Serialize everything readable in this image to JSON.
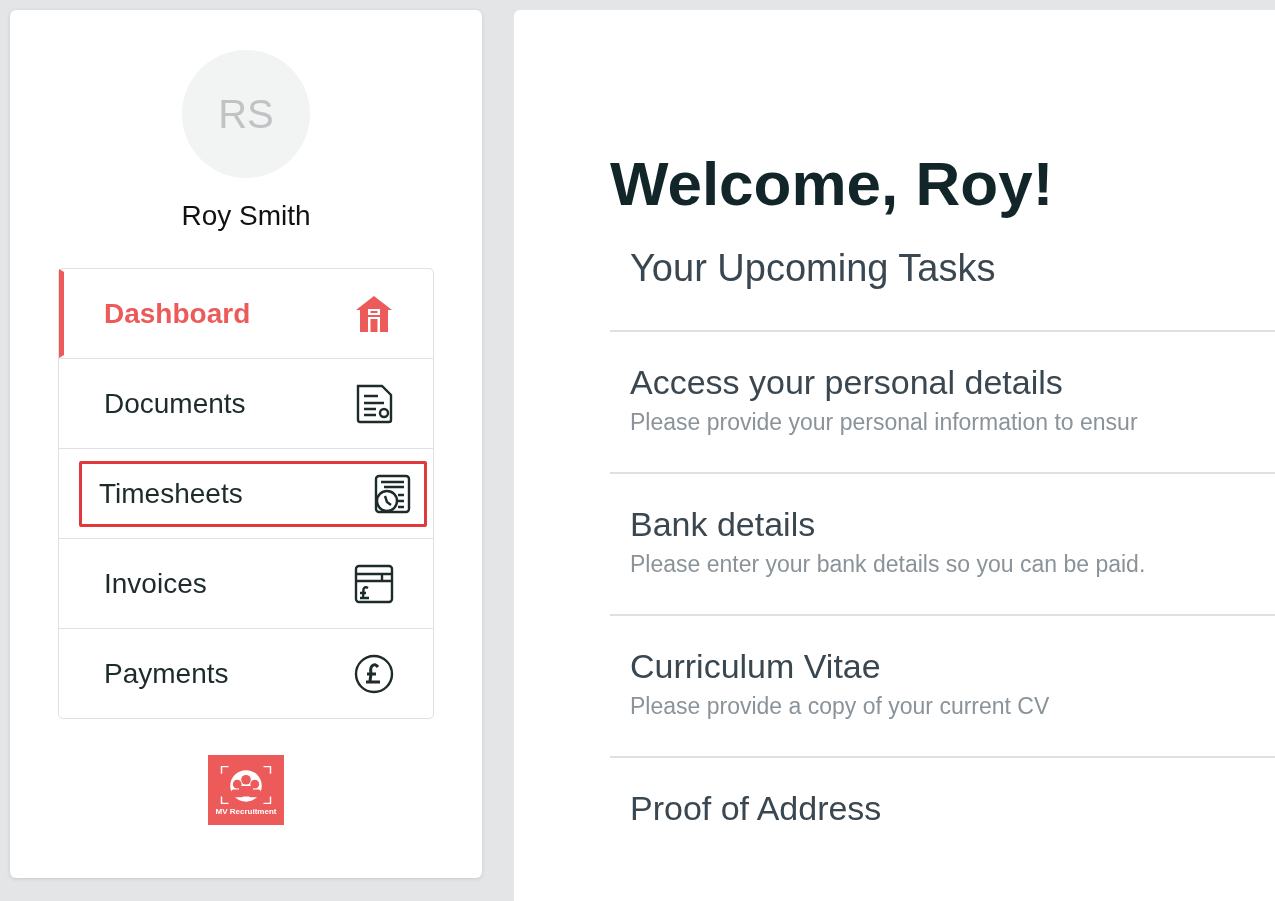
{
  "profile": {
    "initials": "RS",
    "name": "Roy Smith"
  },
  "nav": [
    {
      "label": "Dashboard",
      "selected": true,
      "highlighted": false
    },
    {
      "label": "Documents",
      "selected": false,
      "highlighted": false
    },
    {
      "label": "Timesheets",
      "selected": false,
      "highlighted": true
    },
    {
      "label": "Invoices",
      "selected": false,
      "highlighted": false
    },
    {
      "label": "Payments",
      "selected": false,
      "highlighted": false
    }
  ],
  "logo": {
    "caption": "MV Recruitment"
  },
  "main": {
    "heading": "Welcome, Roy!",
    "subheading": "Your Upcoming Tasks",
    "tasks": [
      {
        "title": "Access your personal details",
        "description": "Please provide your personal information to ensur"
      },
      {
        "title": "Bank details",
        "description": "Please enter your bank details so you can be paid."
      },
      {
        "title": "Curriculum Vitae",
        "description": "Please provide a copy of your current CV"
      },
      {
        "title": "Proof of Address"
      }
    ]
  }
}
